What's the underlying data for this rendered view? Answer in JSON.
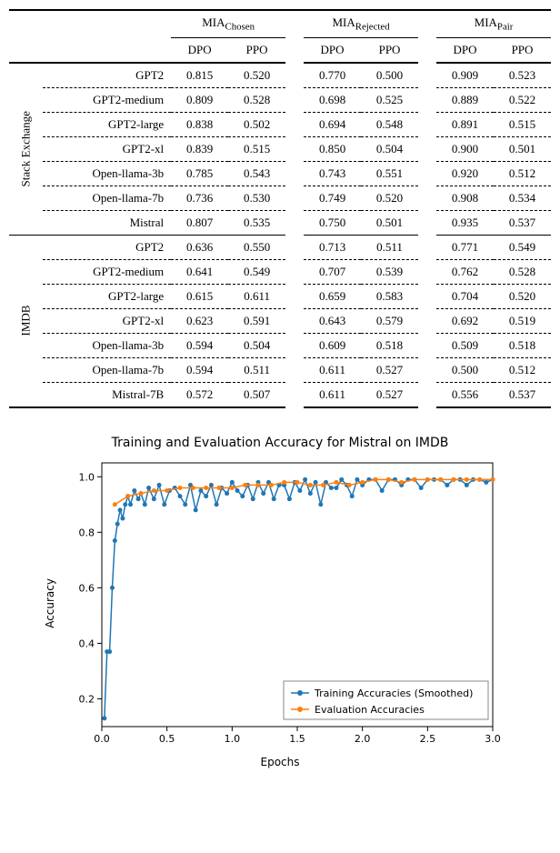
{
  "table": {
    "group_headers": [
      "MIA",
      "MIA",
      "MIA"
    ],
    "group_subs": [
      "Chosen",
      "Rejected",
      "Pair"
    ],
    "sub_headers": [
      "DPO",
      "PPO",
      "DPO",
      "PPO",
      "DPO",
      "PPO"
    ],
    "sections": [
      {
        "name": "Stack Exchange",
        "rows": [
          {
            "model": "GPT2",
            "v": [
              "0.815",
              "0.520",
              "0.770",
              "0.500",
              "0.909",
              "0.523"
            ]
          },
          {
            "model": "GPT2-medium",
            "v": [
              "0.809",
              "0.528",
              "0.698",
              "0.525",
              "0.889",
              "0.522"
            ]
          },
          {
            "model": "GPT2-large",
            "v": [
              "0.838",
              "0.502",
              "0.694",
              "0.548",
              "0.891",
              "0.515"
            ]
          },
          {
            "model": "GPT2-xl",
            "v": [
              "0.839",
              "0.515",
              "0.850",
              "0.504",
              "0.900",
              "0.501"
            ]
          },
          {
            "model": "Open-llama-3b",
            "v": [
              "0.785",
              "0.543",
              "0.743",
              "0.551",
              "0.920",
              "0.512"
            ]
          },
          {
            "model": "Open-llama-7b",
            "v": [
              "0.736",
              "0.530",
              "0.749",
              "0.520",
              "0.908",
              "0.534"
            ]
          },
          {
            "model": "Mistral",
            "v": [
              "0.807",
              "0.535",
              "0.750",
              "0.501",
              "0.935",
              "0.537"
            ]
          }
        ]
      },
      {
        "name": "IMDB",
        "rows": [
          {
            "model": "GPT2",
            "v": [
              "0.636",
              "0.550",
              "0.713",
              "0.511",
              "0.771",
              "0.549"
            ]
          },
          {
            "model": "GPT2-medium",
            "v": [
              "0.641",
              "0.549",
              "0.707",
              "0.539",
              "0.762",
              "0.528"
            ]
          },
          {
            "model": "GPT2-large",
            "v": [
              "0.615",
              "0.611",
              "0.659",
              "0.583",
              "0.704",
              "0.520"
            ]
          },
          {
            "model": "GPT2-xl",
            "v": [
              "0.623",
              "0.591",
              "0.643",
              "0.579",
              "0.692",
              "0.519"
            ]
          },
          {
            "model": "Open-llama-3b",
            "v": [
              "0.594",
              "0.504",
              "0.609",
              "0.518",
              "0.509",
              "0.518"
            ]
          },
          {
            "model": "Open-llama-7b",
            "v": [
              "0.594",
              "0.511",
              "0.611",
              "0.527",
              "0.500",
              "0.512"
            ]
          },
          {
            "model": "Mistral-7B",
            "v": [
              "0.572",
              "0.507",
              "0.611",
              "0.527",
              "0.556",
              "0.537"
            ]
          }
        ]
      }
    ]
  },
  "chart_data": {
    "type": "line",
    "title": "Training and Evaluation Accuracy for Mistral on IMDB",
    "xlabel": "Epochs",
    "ylabel": "Accuracy",
    "xlim": [
      0,
      3.0
    ],
    "ylim": [
      0.1,
      1.05
    ],
    "xticks": [
      0.0,
      0.5,
      1.0,
      1.5,
      2.0,
      2.5,
      3.0
    ],
    "yticks": [
      0.2,
      0.4,
      0.6,
      0.8,
      1.0
    ],
    "legend": [
      "Training Accuracies (Smoothed)",
      "Evaluation Accuracies"
    ],
    "colors": {
      "train": "#1f77b4",
      "eval": "#ff7f0e"
    },
    "series": [
      {
        "name": "Training Accuracies (Smoothed)",
        "color": "#1f77b4",
        "x": [
          0.02,
          0.04,
          0.06,
          0.08,
          0.1,
          0.12,
          0.14,
          0.16,
          0.18,
          0.2,
          0.22,
          0.25,
          0.28,
          0.3,
          0.33,
          0.36,
          0.4,
          0.44,
          0.48,
          0.52,
          0.56,
          0.6,
          0.64,
          0.68,
          0.72,
          0.76,
          0.8,
          0.84,
          0.88,
          0.92,
          0.96,
          1.0,
          1.04,
          1.08,
          1.12,
          1.16,
          1.2,
          1.24,
          1.28,
          1.32,
          1.36,
          1.4,
          1.44,
          1.48,
          1.52,
          1.56,
          1.6,
          1.64,
          1.68,
          1.72,
          1.76,
          1.8,
          1.84,
          1.88,
          1.92,
          1.96,
          2.0,
          2.05,
          2.1,
          2.15,
          2.2,
          2.25,
          2.3,
          2.35,
          2.4,
          2.45,
          2.5,
          2.55,
          2.6,
          2.65,
          2.7,
          2.75,
          2.8,
          2.85,
          2.9,
          2.95,
          3.0
        ],
        "y": [
          0.13,
          0.37,
          0.37,
          0.6,
          0.77,
          0.83,
          0.88,
          0.85,
          0.9,
          0.93,
          0.9,
          0.95,
          0.92,
          0.94,
          0.9,
          0.96,
          0.92,
          0.97,
          0.9,
          0.95,
          0.96,
          0.93,
          0.9,
          0.97,
          0.88,
          0.95,
          0.93,
          0.97,
          0.9,
          0.96,
          0.94,
          0.98,
          0.95,
          0.93,
          0.97,
          0.92,
          0.98,
          0.94,
          0.98,
          0.92,
          0.97,
          0.97,
          0.92,
          0.98,
          0.95,
          0.99,
          0.94,
          0.98,
          0.9,
          0.98,
          0.96,
          0.96,
          0.99,
          0.97,
          0.93,
          0.99,
          0.97,
          0.99,
          0.99,
          0.95,
          0.99,
          0.99,
          0.97,
          0.99,
          0.99,
          0.96,
          0.99,
          0.99,
          0.99,
          0.97,
          0.99,
          0.99,
          0.97,
          0.99,
          0.99,
          0.98,
          0.99
        ]
      },
      {
        "name": "Evaluation Accuracies",
        "color": "#ff7f0e",
        "x": [
          0.1,
          0.2,
          0.3,
          0.4,
          0.5,
          0.6,
          0.7,
          0.8,
          0.9,
          1.0,
          1.1,
          1.2,
          1.3,
          1.4,
          1.5,
          1.6,
          1.7,
          1.8,
          1.9,
          2.0,
          2.1,
          2.2,
          2.3,
          2.4,
          2.5,
          2.6,
          2.7,
          2.8,
          2.9,
          3.0
        ],
        "y": [
          0.9,
          0.93,
          0.94,
          0.95,
          0.95,
          0.96,
          0.96,
          0.96,
          0.96,
          0.96,
          0.97,
          0.97,
          0.97,
          0.98,
          0.98,
          0.97,
          0.97,
          0.98,
          0.97,
          0.98,
          0.99,
          0.99,
          0.98,
          0.99,
          0.99,
          0.99,
          0.99,
          0.99,
          0.99,
          0.99
        ]
      }
    ]
  }
}
